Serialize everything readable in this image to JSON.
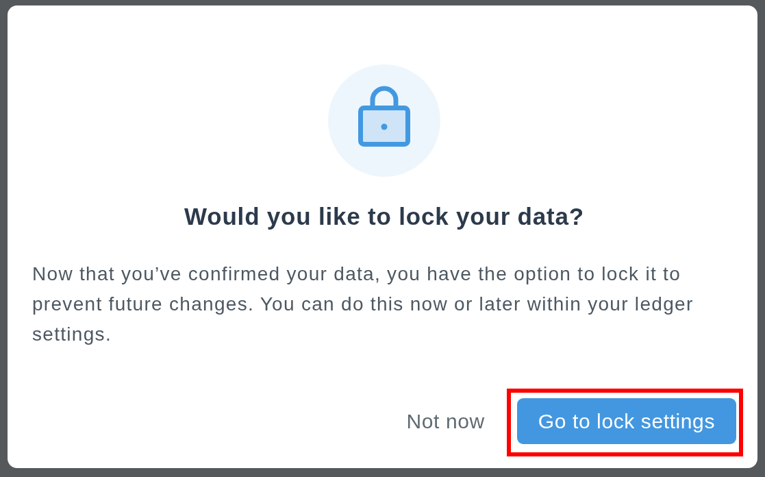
{
  "dialog": {
    "title": "Would you like to lock your data?",
    "message": "Now that you’ve confirmed your data, you have the option to lock it to prevent future changes. You can do this now or later within your ledger settings.",
    "buttons": [
      {
        "label": "Not now",
        "kind": "secondary",
        "highlighted": false
      },
      {
        "label": "Go to lock settings",
        "kind": "primary",
        "highlighted": true
      }
    ]
  }
}
